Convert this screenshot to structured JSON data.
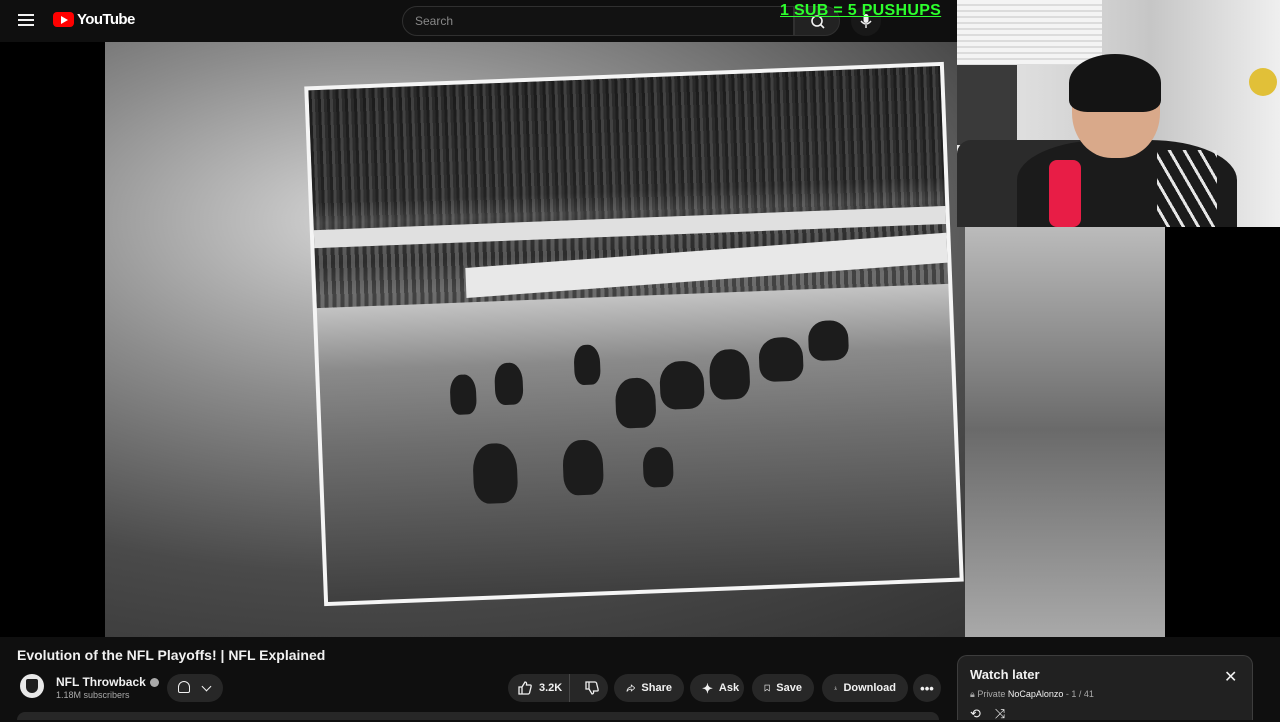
{
  "header": {
    "brand": "YouTube",
    "search_placeholder": "Search",
    "icons": {
      "menu": "hamburger-icon",
      "search": "search-icon",
      "mic": "microphone-icon"
    }
  },
  "overlay": {
    "text": "1 SUB = 5 PUSHUPS",
    "color": "#2dff2d"
  },
  "video": {
    "title": "Evolution of the NFL Playoffs! | NFL Explained",
    "channel": {
      "name": "NFL Throwback",
      "subscribers": "1.18M subscribers",
      "verified": true
    },
    "actions": {
      "likes": "3.2K",
      "share": "Share",
      "ask": "Ask",
      "save": "Save",
      "download": "Download"
    }
  },
  "watch_later": {
    "title": "Watch later",
    "privacy": "Private",
    "owner": "NoCapAlonzo",
    "position": "1 / 41"
  },
  "colors": {
    "brand_red": "#ff0000",
    "background": "#0f0f0f",
    "pill": "#272727"
  }
}
